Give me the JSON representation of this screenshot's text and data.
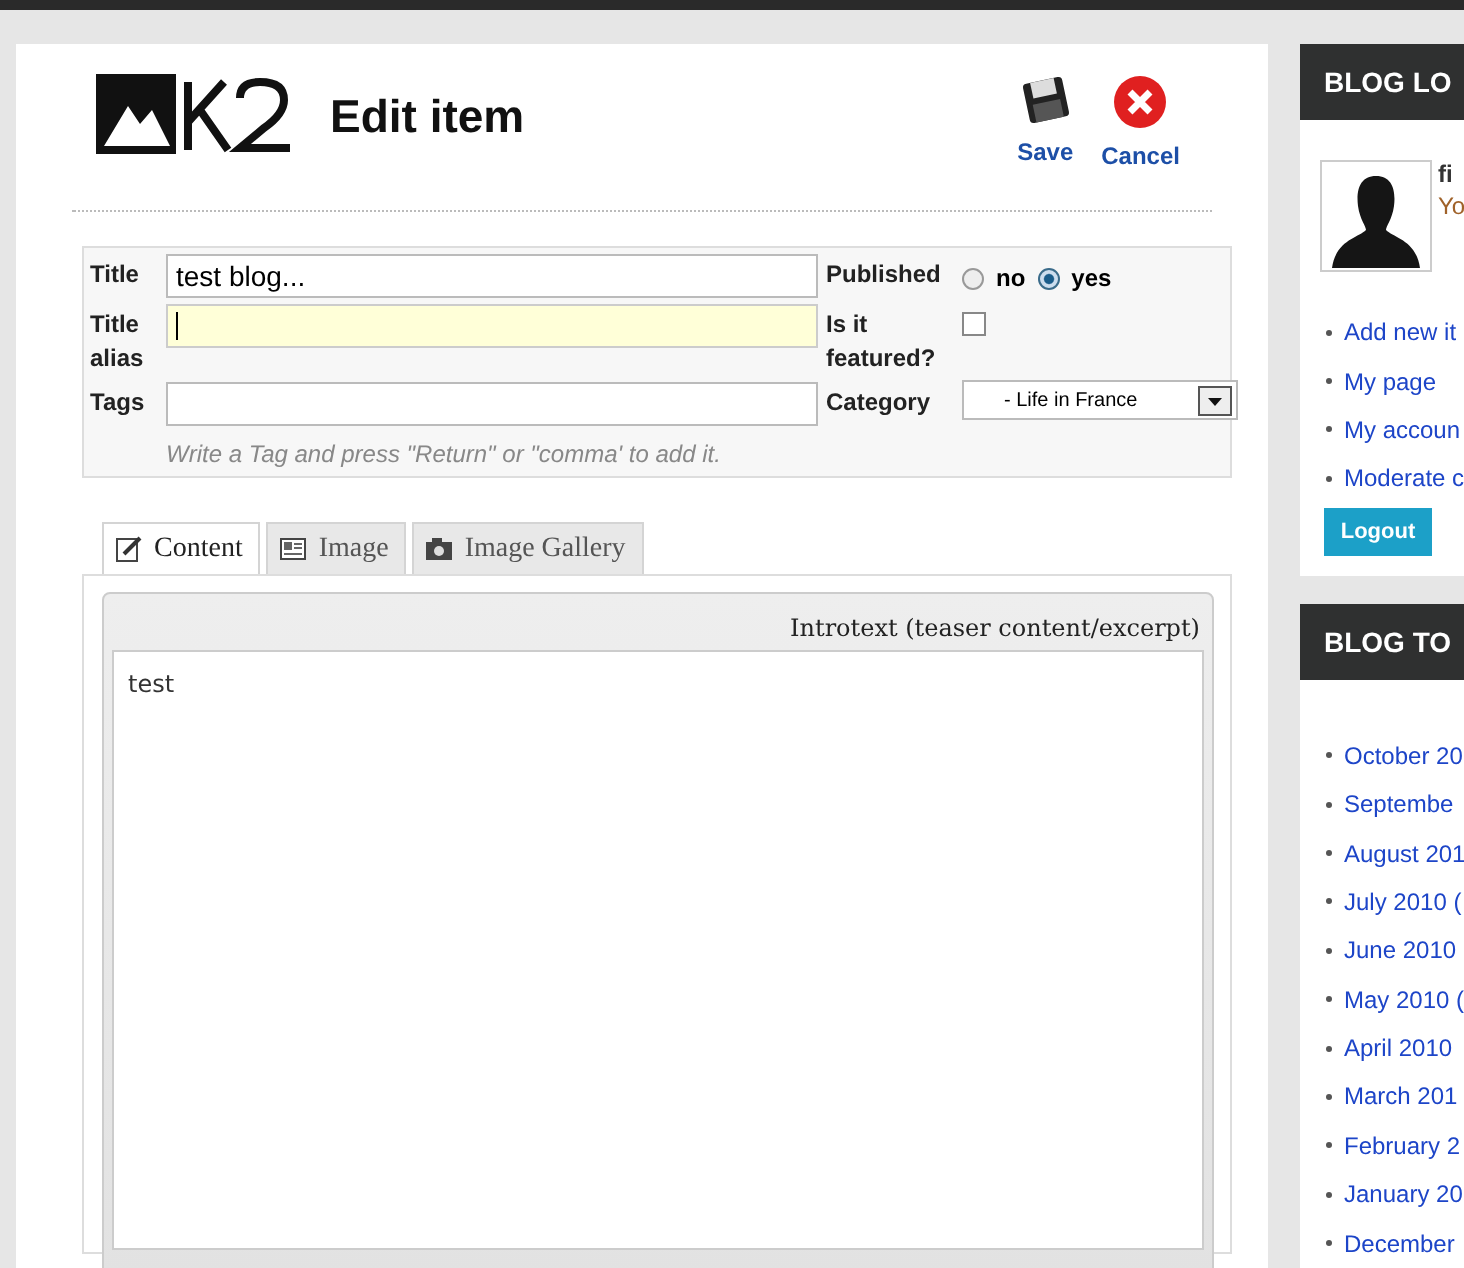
{
  "header": {
    "title": "Edit item",
    "actions": [
      {
        "kind": "save",
        "label": "Save"
      },
      {
        "kind": "cancel",
        "label": "Cancel"
      }
    ]
  },
  "form": {
    "title": {
      "label": "Title",
      "value": "test blog..."
    },
    "alias": {
      "label": "Title alias",
      "focused": true
    },
    "tags": {
      "label": "Tags",
      "hint": "Write a Tag and press \"Return\" or \"comma' to add it."
    },
    "published": {
      "label": "Published",
      "options": [
        {
          "label": "no",
          "selected": false
        },
        {
          "label": "yes",
          "selected": true
        }
      ]
    },
    "featured": {
      "label": "Is it featured?",
      "checked": false
    },
    "category": {
      "label": "Category",
      "value": "- Life in France"
    }
  },
  "tabs": [
    {
      "kind": "content",
      "label": "Content",
      "selected": true
    },
    {
      "kind": "image",
      "label": "Image",
      "selected": false
    },
    {
      "kind": "gallery",
      "label": "Image Gallery",
      "selected": false
    }
  ],
  "editor": {
    "label": "Introtext (teaser content/excerpt)",
    "value": "test"
  },
  "sidebar": {
    "login": {
      "title": "BLOG LO",
      "user_name": "fi",
      "user_text": "Yo",
      "links": [
        "Add new it",
        "My page",
        "My accoun",
        "Moderate c"
      ],
      "logout": "Logout"
    },
    "archive": {
      "title": "BLOG TO",
      "items": [
        "October 20",
        "Septembe",
        "August 201",
        "July 2010 (",
        "June 2010",
        "May 2010 (",
        "April 2010",
        "March 201",
        "February 2",
        "January 20",
        "December"
      ]
    }
  }
}
